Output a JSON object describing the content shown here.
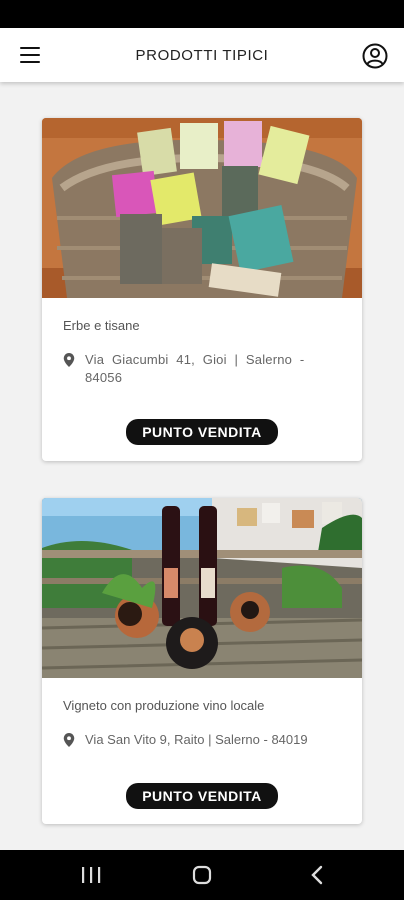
{
  "app_bar": {
    "title": "PRODOTTI TIPICI",
    "menu_icon": "menu-icon",
    "account_icon": "account-circle-icon"
  },
  "cards": [
    {
      "category": "Erbe e tisane",
      "address": "Via Giacumbi 41, Gioi | Salerno - 84056",
      "button_label": "PUNTO VENDITA",
      "image": "herbal-tea-packages-in-basket"
    },
    {
      "category": "Vigneto con produzione vino locale",
      "address": "Via San Vito 9, Raito | Salerno - 84019",
      "button_label": "PUNTO VENDITA",
      "image": "wine-bottles-and-ceramics-on-terrace"
    }
  ],
  "nav": {
    "recents_icon": "recent-apps-icon",
    "home_icon": "home-icon",
    "back_icon": "back-icon"
  },
  "colors": {
    "button_bg": "#111111",
    "app_bar_bg": "#ffffff",
    "page_bg": "#f2f2f2"
  }
}
